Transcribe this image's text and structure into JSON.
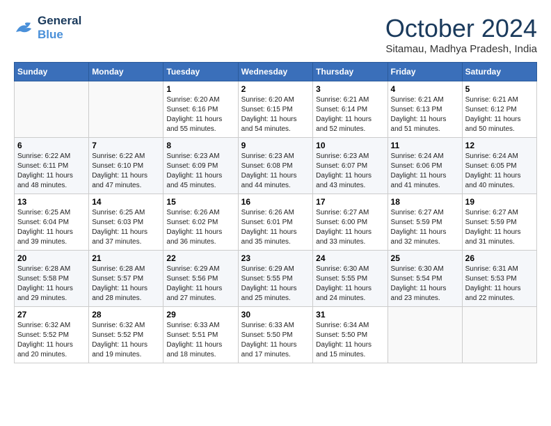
{
  "logo": {
    "line1": "General",
    "line2": "Blue"
  },
  "title": "October 2024",
  "subtitle": "Sitamau, Madhya Pradesh, India",
  "weekdays": [
    "Sunday",
    "Monday",
    "Tuesday",
    "Wednesday",
    "Thursday",
    "Friday",
    "Saturday"
  ],
  "weeks": [
    [
      {
        "day": "",
        "info": ""
      },
      {
        "day": "",
        "info": ""
      },
      {
        "day": "1",
        "info": "Sunrise: 6:20 AM\nSunset: 6:16 PM\nDaylight: 11 hours and 55 minutes."
      },
      {
        "day": "2",
        "info": "Sunrise: 6:20 AM\nSunset: 6:15 PM\nDaylight: 11 hours and 54 minutes."
      },
      {
        "day": "3",
        "info": "Sunrise: 6:21 AM\nSunset: 6:14 PM\nDaylight: 11 hours and 52 minutes."
      },
      {
        "day": "4",
        "info": "Sunrise: 6:21 AM\nSunset: 6:13 PM\nDaylight: 11 hours and 51 minutes."
      },
      {
        "day": "5",
        "info": "Sunrise: 6:21 AM\nSunset: 6:12 PM\nDaylight: 11 hours and 50 minutes."
      }
    ],
    [
      {
        "day": "6",
        "info": "Sunrise: 6:22 AM\nSunset: 6:11 PM\nDaylight: 11 hours and 48 minutes."
      },
      {
        "day": "7",
        "info": "Sunrise: 6:22 AM\nSunset: 6:10 PM\nDaylight: 11 hours and 47 minutes."
      },
      {
        "day": "8",
        "info": "Sunrise: 6:23 AM\nSunset: 6:09 PM\nDaylight: 11 hours and 45 minutes."
      },
      {
        "day": "9",
        "info": "Sunrise: 6:23 AM\nSunset: 6:08 PM\nDaylight: 11 hours and 44 minutes."
      },
      {
        "day": "10",
        "info": "Sunrise: 6:23 AM\nSunset: 6:07 PM\nDaylight: 11 hours and 43 minutes."
      },
      {
        "day": "11",
        "info": "Sunrise: 6:24 AM\nSunset: 6:06 PM\nDaylight: 11 hours and 41 minutes."
      },
      {
        "day": "12",
        "info": "Sunrise: 6:24 AM\nSunset: 6:05 PM\nDaylight: 11 hours and 40 minutes."
      }
    ],
    [
      {
        "day": "13",
        "info": "Sunrise: 6:25 AM\nSunset: 6:04 PM\nDaylight: 11 hours and 39 minutes."
      },
      {
        "day": "14",
        "info": "Sunrise: 6:25 AM\nSunset: 6:03 PM\nDaylight: 11 hours and 37 minutes."
      },
      {
        "day": "15",
        "info": "Sunrise: 6:26 AM\nSunset: 6:02 PM\nDaylight: 11 hours and 36 minutes."
      },
      {
        "day": "16",
        "info": "Sunrise: 6:26 AM\nSunset: 6:01 PM\nDaylight: 11 hours and 35 minutes."
      },
      {
        "day": "17",
        "info": "Sunrise: 6:27 AM\nSunset: 6:00 PM\nDaylight: 11 hours and 33 minutes."
      },
      {
        "day": "18",
        "info": "Sunrise: 6:27 AM\nSunset: 5:59 PM\nDaylight: 11 hours and 32 minutes."
      },
      {
        "day": "19",
        "info": "Sunrise: 6:27 AM\nSunset: 5:59 PM\nDaylight: 11 hours and 31 minutes."
      }
    ],
    [
      {
        "day": "20",
        "info": "Sunrise: 6:28 AM\nSunset: 5:58 PM\nDaylight: 11 hours and 29 minutes."
      },
      {
        "day": "21",
        "info": "Sunrise: 6:28 AM\nSunset: 5:57 PM\nDaylight: 11 hours and 28 minutes."
      },
      {
        "day": "22",
        "info": "Sunrise: 6:29 AM\nSunset: 5:56 PM\nDaylight: 11 hours and 27 minutes."
      },
      {
        "day": "23",
        "info": "Sunrise: 6:29 AM\nSunset: 5:55 PM\nDaylight: 11 hours and 25 minutes."
      },
      {
        "day": "24",
        "info": "Sunrise: 6:30 AM\nSunset: 5:55 PM\nDaylight: 11 hours and 24 minutes."
      },
      {
        "day": "25",
        "info": "Sunrise: 6:30 AM\nSunset: 5:54 PM\nDaylight: 11 hours and 23 minutes."
      },
      {
        "day": "26",
        "info": "Sunrise: 6:31 AM\nSunset: 5:53 PM\nDaylight: 11 hours and 22 minutes."
      }
    ],
    [
      {
        "day": "27",
        "info": "Sunrise: 6:32 AM\nSunset: 5:52 PM\nDaylight: 11 hours and 20 minutes."
      },
      {
        "day": "28",
        "info": "Sunrise: 6:32 AM\nSunset: 5:52 PM\nDaylight: 11 hours and 19 minutes."
      },
      {
        "day": "29",
        "info": "Sunrise: 6:33 AM\nSunset: 5:51 PM\nDaylight: 11 hours and 18 minutes."
      },
      {
        "day": "30",
        "info": "Sunrise: 6:33 AM\nSunset: 5:50 PM\nDaylight: 11 hours and 17 minutes."
      },
      {
        "day": "31",
        "info": "Sunrise: 6:34 AM\nSunset: 5:50 PM\nDaylight: 11 hours and 15 minutes."
      },
      {
        "day": "",
        "info": ""
      },
      {
        "day": "",
        "info": ""
      }
    ]
  ]
}
